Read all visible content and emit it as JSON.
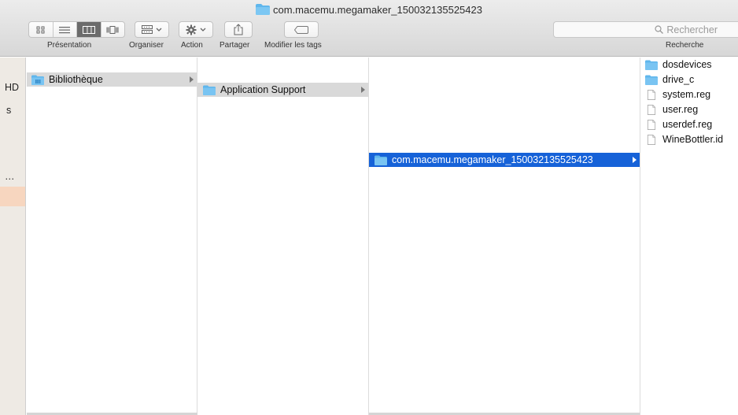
{
  "window": {
    "title": "com.macemu.megamaker_150032135525423"
  },
  "toolbar": {
    "presentation_label": "Présentation",
    "organiser_label": "Organiser",
    "action_label": "Action",
    "partager_label": "Partager",
    "tags_label": "Modifier les tags",
    "search_placeholder": "Rechercher",
    "search_label": "Recherche",
    "active_view": "columns"
  },
  "sidebar": {
    "items": [
      {
        "label": "HD"
      },
      {
        "label": "s"
      },
      {
        "label": "…"
      }
    ]
  },
  "columns": [
    {
      "items": [
        {
          "label": "Bibliothèque",
          "icon": "library-folder-icon",
          "selected": true,
          "has_children": true
        }
      ]
    },
    {
      "items": [
        {
          "label": "Application Support",
          "icon": "folder-icon",
          "selected": true,
          "has_children": true
        }
      ]
    },
    {
      "items": [
        {
          "label": "com.macemu.megamaker_150032135525423",
          "icon": "folder-icon",
          "selected": true,
          "active": true,
          "has_children": true
        }
      ]
    },
    {
      "items": [
        {
          "label": "dosdevices",
          "icon": "folder-icon"
        },
        {
          "label": "drive_c",
          "icon": "folder-icon"
        },
        {
          "label": "system.reg",
          "icon": "document-icon"
        },
        {
          "label": "user.reg",
          "icon": "document-icon"
        },
        {
          "label": "userdef.reg",
          "icon": "document-icon"
        },
        {
          "label": "WineBottler.id",
          "icon": "document-icon"
        }
      ]
    }
  ],
  "colors": {
    "selection_active": "#1662d8",
    "selection_inactive": "#d9d9d9",
    "folder": "#5fb6ec",
    "sidebar_selection": "#f7d6bf"
  }
}
